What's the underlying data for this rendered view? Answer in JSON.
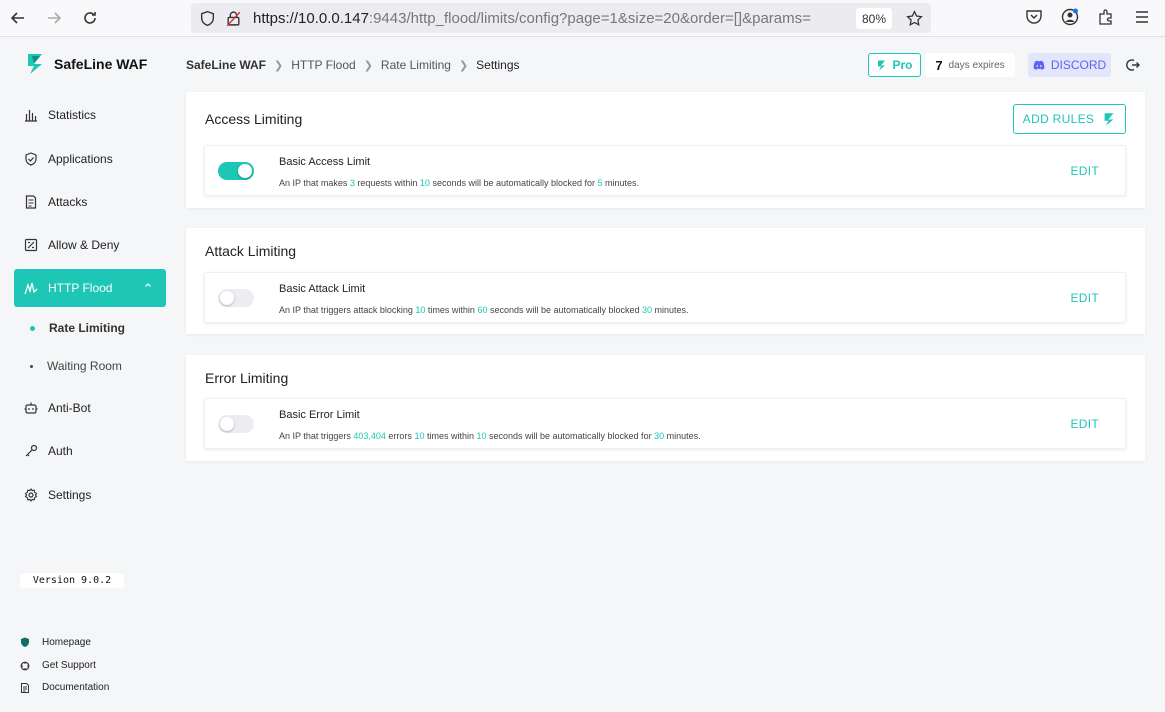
{
  "browser": {
    "url_main": "https://10.0.0.147",
    "url_rest": ":9443/http_flood/limits/config?page=1&size=20&order=[]&params=",
    "zoom": "80%"
  },
  "sidebar": {
    "logo_text": "SafeLine WAF",
    "items": [
      {
        "label": "Statistics"
      },
      {
        "label": "Applications"
      },
      {
        "label": "Attacks"
      },
      {
        "label": "Allow & Deny"
      },
      {
        "label": "HTTP Flood"
      },
      {
        "label": "Anti-Bot"
      },
      {
        "label": "Auth"
      },
      {
        "label": "Settings"
      }
    ],
    "sub_items": [
      {
        "label": "Rate Limiting"
      },
      {
        "label": "Waiting Room"
      }
    ],
    "version": "Version 9.0.2",
    "footer": [
      {
        "label": "Homepage"
      },
      {
        "label": "Get Support"
      },
      {
        "label": "Documentation"
      }
    ]
  },
  "header": {
    "breadcrumb": [
      "SafeLine WAF",
      "HTTP Flood",
      "Rate Limiting",
      "Settings"
    ],
    "pro_label": "Pro",
    "expires_num": "7",
    "expires_label": "days expires",
    "discord_label": "DISCORD"
  },
  "sections": [
    {
      "title": "Access Limiting",
      "add_rules_label": "ADD RULES",
      "rule": {
        "name": "Basic Access Limit",
        "enabled": true,
        "desc": [
          "An IP that makes ",
          "3",
          " requests within ",
          "10",
          " seconds will be automatically blocked for ",
          "5",
          " minutes."
        ],
        "edit_label": "EDIT"
      }
    },
    {
      "title": "Attack Limiting",
      "rule": {
        "name": "Basic Attack Limit",
        "enabled": false,
        "desc": [
          "An IP that triggers attack blocking ",
          "10",
          " times within ",
          "60",
          " seconds will be automatically blocked ",
          "30",
          " minutes."
        ],
        "edit_label": "EDIT"
      }
    },
    {
      "title": "Error Limiting",
      "rule": {
        "name": "Basic Error Limit",
        "enabled": false,
        "desc": [
          "An IP that triggers ",
          "403,404",
          " errors ",
          "10",
          " times within ",
          "10",
          " seconds will be automatically blocked for ",
          "30",
          " minutes."
        ],
        "edit_label": "EDIT"
      }
    }
  ],
  "colors": {
    "accent": "#1ec6b6",
    "discord": "#5865f2"
  }
}
